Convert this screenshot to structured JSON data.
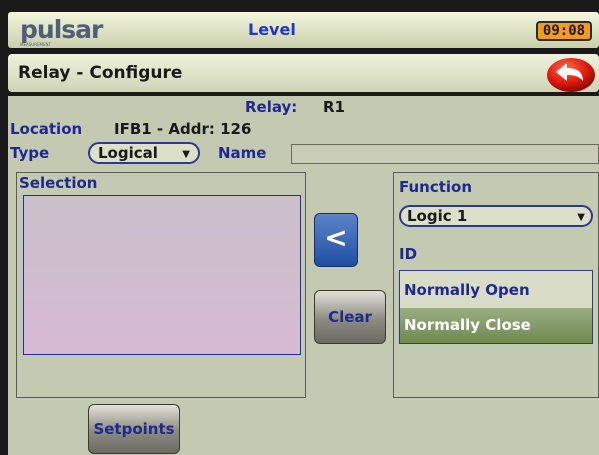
{
  "topbar": {
    "logo_text": "pulsar",
    "logo_sub": "MEASUREMENT",
    "title": "Level",
    "clock": "09:08"
  },
  "header": {
    "title": "Relay - Configure"
  },
  "relay": {
    "label": "Relay:",
    "value": "R1"
  },
  "location": {
    "label": "Location",
    "value": "IFB1 - Addr: 126"
  },
  "type": {
    "label": "Type",
    "selected": "Logical"
  },
  "name": {
    "label": "Name",
    "value": ""
  },
  "selection": {
    "label": "Selection"
  },
  "buttons": {
    "assign": "<",
    "clear": "Clear",
    "setpoints": "Setpoints"
  },
  "function": {
    "label": "Function",
    "selected": "Logic 1"
  },
  "id": {
    "label": "ID",
    "options": [
      "Normally Open",
      "Normally Close"
    ]
  },
  "colors": {
    "accent_blue": "#1f2a8f",
    "clock_orange": "#f39a1f",
    "selected_green": "#6f8a52"
  }
}
